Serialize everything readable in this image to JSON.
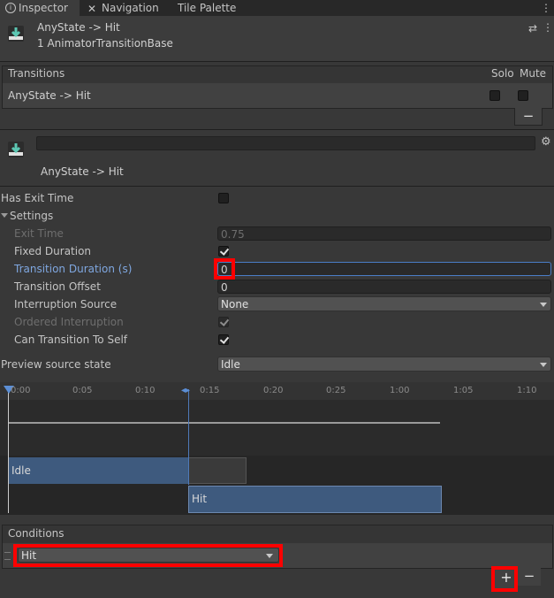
{
  "tabs": [
    {
      "label": "Inspector",
      "icon": "info-icon",
      "active": true
    },
    {
      "label": "Navigation",
      "icon": "navigation-icon",
      "active": false
    },
    {
      "label": "Tile Palette",
      "icon": "",
      "active": false
    }
  ],
  "header": {
    "title": "AnyState -> Hit",
    "subtitle": "1 AnimatorTransitionBase"
  },
  "transitions": {
    "header": "Transitions",
    "solo_label": "Solo",
    "mute_label": "Mute",
    "row_label": "AnyState -> Hit",
    "remove_label": "−"
  },
  "transition": {
    "name": "AnyState -> Hit"
  },
  "settings": {
    "has_exit_time_label": "Has Exit Time",
    "settings_label": "Settings",
    "exit_time_label": "Exit Time",
    "exit_time_value": "0.75",
    "fixed_duration_label": "Fixed Duration",
    "transition_duration_label": "Transition Duration (s)",
    "transition_duration_value": "0",
    "transition_offset_label": "Transition Offset",
    "transition_offset_value": "0",
    "interruption_source_label": "Interruption Source",
    "interruption_source_value": "None",
    "ordered_interruption_label": "Ordered Interruption",
    "can_transition_label": "Can Transition To Self",
    "preview_label": "Preview source state",
    "preview_value": "Idle"
  },
  "timeline": {
    "ticks": [
      "0:00",
      "0:05",
      "0:10",
      "0:15",
      "0:20",
      "0:25",
      "1:00",
      "1:05",
      "1:10"
    ],
    "idle_label": "Idle",
    "hit_label": "Hit"
  },
  "conditions": {
    "header": "Conditions",
    "value": "Hit",
    "add_label": "+",
    "remove_label": "−"
  },
  "colors": {
    "accent": "#7fa7e0",
    "highlight": "#ff0000",
    "bar": "#3e5a7e"
  }
}
